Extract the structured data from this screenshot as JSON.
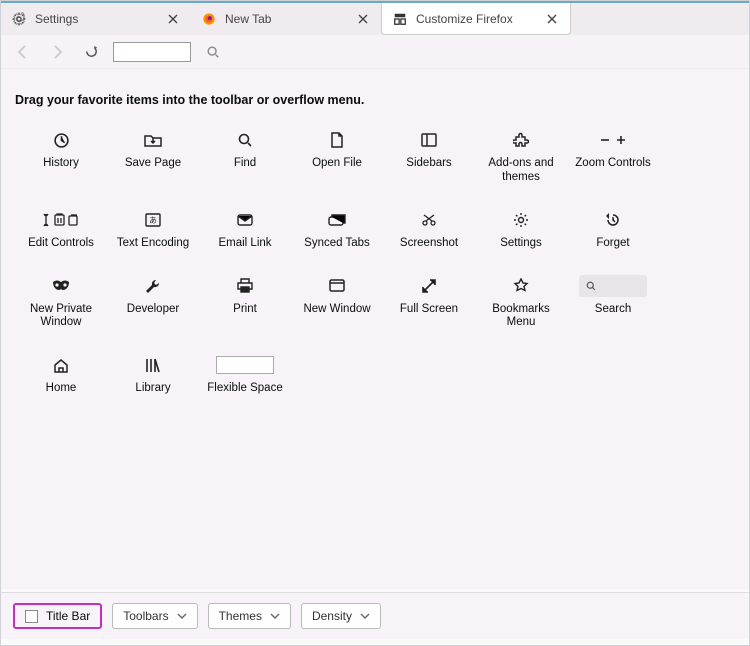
{
  "tabs": [
    {
      "icon": "gear",
      "label": "Settings"
    },
    {
      "icon": "firefox",
      "label": "New Tab"
    },
    {
      "icon": "customize",
      "label": "Customize Firefox"
    }
  ],
  "active_tab": 2,
  "instruction": "Drag your favorite items into the toolbar or overflow menu.",
  "items": [
    {
      "icon": "clock",
      "label": "History"
    },
    {
      "icon": "folder-down",
      "label": "Save Page"
    },
    {
      "icon": "magnify",
      "label": "Find"
    },
    {
      "icon": "file",
      "label": "Open File"
    },
    {
      "icon": "sidebar",
      "label": "Sidebars"
    },
    {
      "icon": "puzzle",
      "label": "Add-ons and themes"
    },
    {
      "icon": "zoom",
      "label": "Zoom Controls"
    },
    {
      "icon": "editgroup",
      "label": "Edit Controls"
    },
    {
      "icon": "encoding",
      "label": "Text Encoding"
    },
    {
      "icon": "mail",
      "label": "Email Link"
    },
    {
      "icon": "tabs",
      "label": "Synced Tabs"
    },
    {
      "icon": "screenshot",
      "label": "Screenshot"
    },
    {
      "icon": "gear",
      "label": "Settings"
    },
    {
      "icon": "history-back",
      "label": "Forget"
    },
    {
      "icon": "mask",
      "label": "New Private Window"
    },
    {
      "icon": "wrench",
      "label": "Developer"
    },
    {
      "icon": "print",
      "label": "Print"
    },
    {
      "icon": "window",
      "label": "New Window"
    },
    {
      "icon": "fullscreen",
      "label": "Full Screen"
    },
    {
      "icon": "star",
      "label": "Bookmarks Menu"
    },
    {
      "icon": "search-box",
      "label": "Search"
    },
    {
      "icon": "home",
      "label": "Home"
    },
    {
      "icon": "library",
      "label": "Library"
    },
    {
      "icon": "flex",
      "label": "Flexible Space"
    }
  ],
  "footer": {
    "titlebar_label": "Title Bar",
    "dropdowns": [
      {
        "label": "Toolbars"
      },
      {
        "label": "Themes"
      },
      {
        "label": "Density"
      }
    ]
  }
}
